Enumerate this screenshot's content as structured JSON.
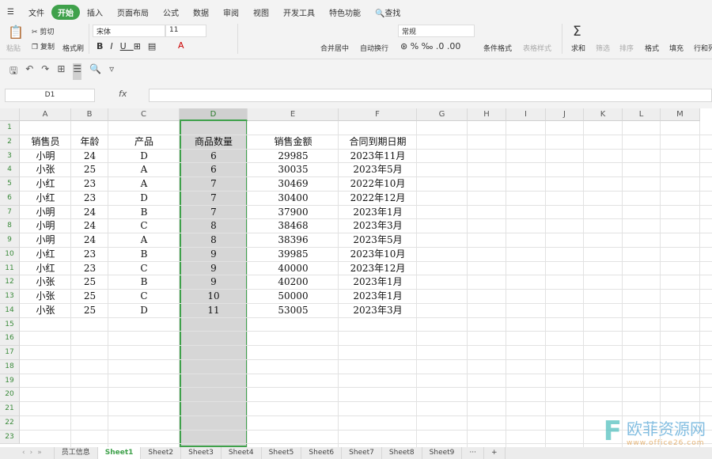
{
  "menu": {
    "items": [
      "文件",
      "开始",
      "插入",
      "页面布局",
      "公式",
      "数据",
      "审阅",
      "视图",
      "开发工具",
      "特色功能"
    ],
    "search": "查找",
    "active": 1
  },
  "ribbon": {
    "paste": "粘贴",
    "cut": "剪切",
    "copy": "复制",
    "format_painter": "格式刷",
    "font": "宋体",
    "size": "11",
    "merge": "合并居中",
    "wrap": "自动换行",
    "number_format": "常规",
    "cond_format": "条件格式",
    "table_style": "表格样式",
    "sum": "求和",
    "filter": "筛选",
    "sort": "排序",
    "format": "格式",
    "fill": "填充",
    "rowcol": "行和列"
  },
  "formula_bar": {
    "name_box": "D1",
    "fx": "fx",
    "value": ""
  },
  "grid": {
    "columns": [
      "A",
      "B",
      "C",
      "D",
      "E",
      "F",
      "G",
      "H",
      "I",
      "J",
      "K",
      "L",
      "M"
    ],
    "selected_column": "D",
    "headers": [
      "销售员",
      "年龄",
      "产品",
      "商品数量",
      "销售金额",
      "合同到期日期"
    ],
    "rows": [
      [
        "小明",
        "24",
        "D",
        "6",
        "29985",
        "2023年11月"
      ],
      [
        "小张",
        "25",
        "A",
        "6",
        "30035",
        "2023年5月"
      ],
      [
        "小红",
        "23",
        "A",
        "7",
        "30469",
        "2022年10月"
      ],
      [
        "小红",
        "23",
        "D",
        "7",
        "30400",
        "2022年12月"
      ],
      [
        "小明",
        "24",
        "B",
        "7",
        "37900",
        "2023年1月"
      ],
      [
        "小明",
        "24",
        "C",
        "8",
        "38468",
        "2023年3月"
      ],
      [
        "小明",
        "24",
        "A",
        "8",
        "38396",
        "2023年5月"
      ],
      [
        "小红",
        "23",
        "B",
        "9",
        "39985",
        "2023年10月"
      ],
      [
        "小红",
        "23",
        "C",
        "9",
        "40000",
        "2023年12月"
      ],
      [
        "小张",
        "25",
        "B",
        "9",
        "40200",
        "2023年1月"
      ],
      [
        "小张",
        "25",
        "C",
        "10",
        "50000",
        "2023年1月"
      ],
      [
        "小张",
        "25",
        "D",
        "11",
        "53005",
        "2023年3月"
      ]
    ]
  },
  "sheets": {
    "tabs": [
      "员工信息",
      "Sheet1",
      "Sheet2",
      "Sheet3",
      "Sheet4",
      "Sheet5",
      "Sheet6",
      "Sheet7",
      "Sheet8",
      "Sheet9"
    ],
    "active": 1,
    "more": "···",
    "add": "+"
  },
  "watermark": {
    "title": "欧菲资源网",
    "url": "www.office26.com"
  },
  "colors": {
    "accent": "#3fa14b"
  }
}
